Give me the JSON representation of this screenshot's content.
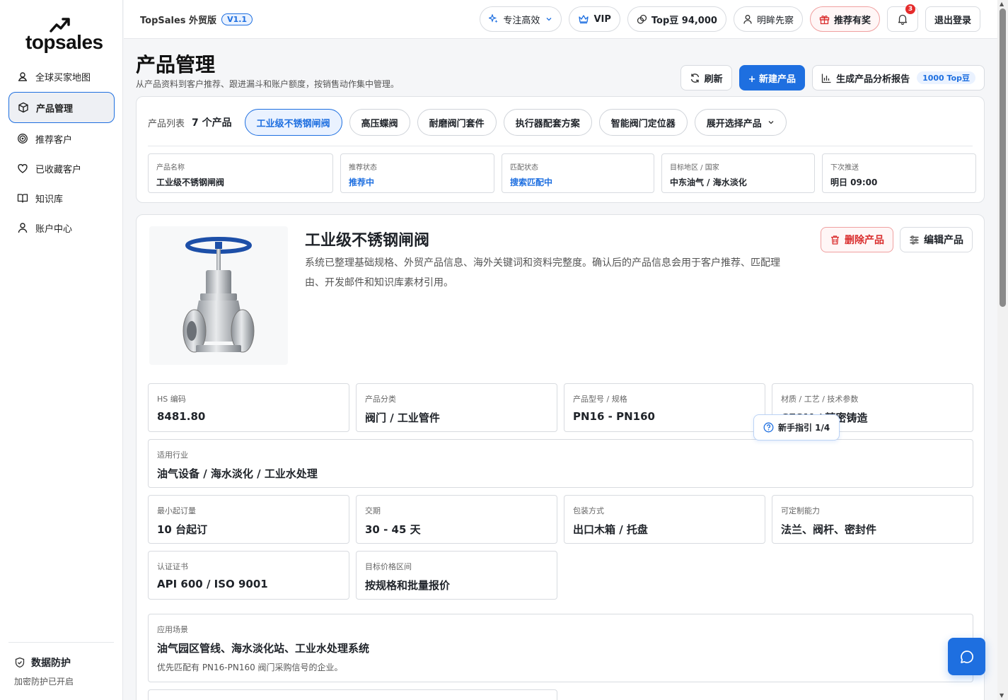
{
  "sidebar": {
    "logo": "topsales",
    "items": [
      {
        "label": "全球买家地图",
        "icon": "map-user-icon"
      },
      {
        "label": "产品管理",
        "icon": "box-icon"
      },
      {
        "label": "推荐客户",
        "icon": "target-icon"
      },
      {
        "label": "已收藏客户",
        "icon": "heart-icon"
      },
      {
        "label": "知识库",
        "icon": "book-icon"
      },
      {
        "label": "账户中心",
        "icon": "user-icon"
      }
    ],
    "footer": {
      "title": "数据防护",
      "subtitle": "加密防护已开启"
    }
  },
  "topbar": {
    "brand": "TopSales 外贸版",
    "version": "V1.1",
    "mode": "专注高效",
    "vip": "VIP",
    "beans": "Top豆 94,000",
    "user": "明眸先察",
    "referral": "推荐有奖",
    "notif_count": "3",
    "logout": "退出登录"
  },
  "page": {
    "title": "产品管理",
    "subtitle": "从产品资料到客户推荐、跟进漏斗和账户额度，按销售动作集中管理。",
    "refresh": "刷新",
    "new_product": "+ 新建产品",
    "report": "生成产品分析报告",
    "report_cost": "1000 Top豆"
  },
  "product_list": {
    "label": "产品列表",
    "count": "7 个产品",
    "tabs": [
      "工业级不锈钢闸阀",
      "高压蝶阀",
      "耐磨阀门套件",
      "执行器配套方案",
      "智能阀门定位器"
    ],
    "expand": "展开选择产品",
    "summary": [
      {
        "k": "产品名称",
        "v": "工业级不锈钢闸阀"
      },
      {
        "k": "推荐状态",
        "v": "推荐中"
      },
      {
        "k": "匹配状态",
        "v": "搜索匹配中"
      },
      {
        "k": "目标地区 / 国家",
        "v": "中东油气 / 海水淡化"
      },
      {
        "k": "下次推送",
        "v": "明日 09:00"
      }
    ]
  },
  "detail": {
    "name": "工业级不锈钢闸阀",
    "description": "系统已整理基础规格、外贸产品信息、海外关键词和资料完整度。确认后的产品信息会用于客户推荐、匹配理由、开发邮件和知识库素材引用。",
    "delete": "删除产品",
    "edit": "编辑产品",
    "fields": {
      "hs": {
        "k": "HS 编码",
        "v": "8481.80"
      },
      "category": {
        "k": "产品分类",
        "v": "阀门 / 工业管件"
      },
      "model": {
        "k": "产品型号 / 规格",
        "v": "PN16 - PN160"
      },
      "material": {
        "k": "材质 / 工艺 / 技术参数",
        "v": "CF8M / 精密铸造"
      },
      "industry": {
        "k": "适用行业",
        "v": "油气设备 / 海水淡化 / 工业水处理"
      },
      "moq": {
        "k": "最小起订量",
        "v": "10 台起订"
      },
      "lead": {
        "k": "交期",
        "v": "30 - 45 天"
      },
      "packing": {
        "k": "包装方式",
        "v": "出口木箱 / 托盘"
      },
      "custom": {
        "k": "可定制能力",
        "v": "法兰、阀杆、密封件"
      },
      "cert": {
        "k": "认证证书",
        "v": "API 600 / ISO 9001"
      },
      "price": {
        "k": "目标价格区间",
        "v": "按规格和批量报价"
      },
      "scenario": {
        "k": "应用场景",
        "v": "油气园区管线、海水淡化站、工业水处理系统",
        "note": "优先匹配有 PN16-PN160 阀门采购信号的企业。"
      }
    }
  },
  "guide": "新手指引 1/4"
}
